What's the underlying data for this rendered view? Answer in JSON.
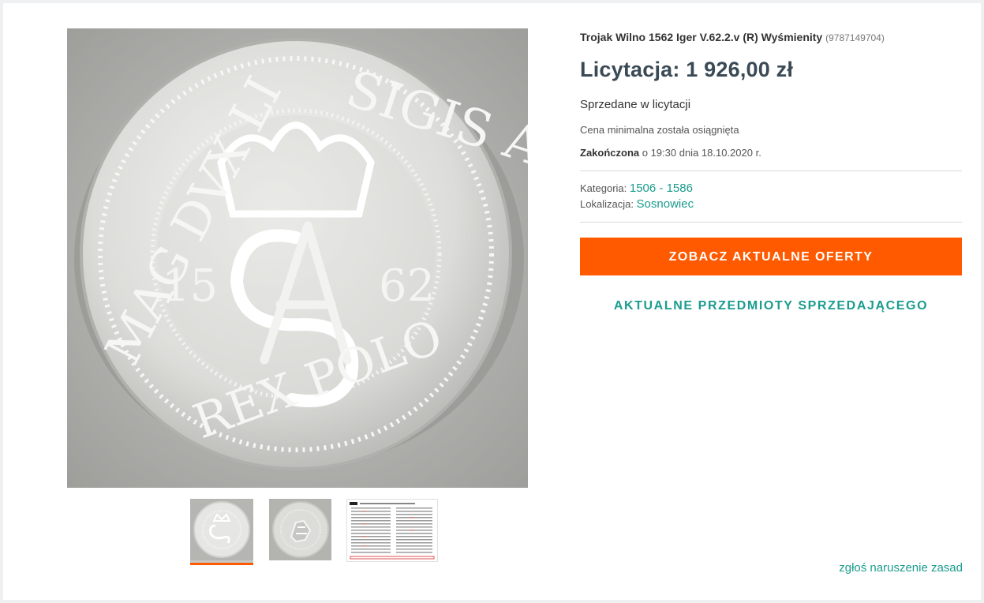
{
  "item": {
    "title": "Trojak Wilno 1562 Iger V.62.2.v (R) Wyśmienity",
    "id": "(9787149704)",
    "price": "Licytacja: 1 926,00 zł",
    "status": "Sprzedane w licytacji",
    "min_price_note": "Cena minimalna została osiągnięta",
    "ended_label": "Zakończona",
    "ended_text": " o 19:30 dnia 18.10.2020 r.",
    "category_label": "Kategoria: ",
    "category_value": "1506 - 1586",
    "location_label": "Lokalizacja: ",
    "location_value": "Sosnowiec"
  },
  "actions": {
    "primary": "ZOBACZ AKTUALNE OFERTY",
    "seller_items": "AKTUALNE PRZEDMIOTY SPRZEDAJĄCEGO",
    "report": "zgłoś naruszenie zasad"
  },
  "gallery": {
    "thumbnails": [
      {
        "name": "coin-obverse",
        "active": true
      },
      {
        "name": "coin-reverse",
        "active": false
      },
      {
        "name": "catalog-table",
        "active": false
      }
    ],
    "coin_legend_top": "SIGIS AVG",
    "coin_legend_left": "MAG DVX LI",
    "coin_legend_bottom": "REX POLO",
    "coin_year_left": "15",
    "coin_year_right": "62"
  },
  "colors": {
    "accent": "#ff5a00",
    "link": "#1b9c8e"
  }
}
